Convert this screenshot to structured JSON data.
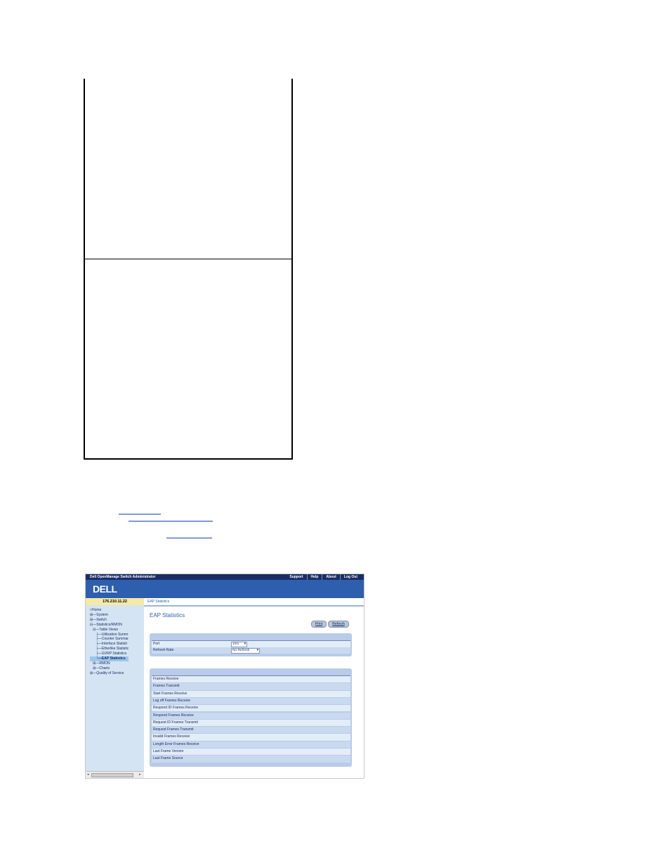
{
  "screenshot": {
    "title": "Dell OpenManage Switch Administrator",
    "nav": [
      "Support",
      "Help",
      "About",
      "Log Out"
    ],
    "logo": "DELL",
    "ip": "176.210.11.22",
    "breadcrumb": "EAP Statistics",
    "tree": [
      {
        "prefix": "□",
        "label": "Home"
      },
      {
        "prefix": "⊞—",
        "label": "System"
      },
      {
        "prefix": "⊞—",
        "label": "Switch"
      },
      {
        "prefix": "⊟—",
        "label": "Statistics/RMON"
      },
      {
        "prefix": "   ⊟—",
        "label": "Table Views"
      },
      {
        "prefix": "      ├—",
        "label": "Utilization Summ"
      },
      {
        "prefix": "      ├—",
        "label": "Counter Summar"
      },
      {
        "prefix": "      ├—",
        "label": "Interface Statisti"
      },
      {
        "prefix": "      ├—",
        "label": "Etherlike Statistic"
      },
      {
        "prefix": "      ├—",
        "label": "GVRP Statistics"
      },
      {
        "prefix": "      └—",
        "label": "EAP Statistics"
      },
      {
        "prefix": "   ⊞—",
        "label": "RMON"
      },
      {
        "prefix": "   ⊞—",
        "label": "Charts"
      },
      {
        "prefix": "⊞—",
        "label": "Quality of Service"
      }
    ],
    "page_title": "EAP Statistics",
    "print_label": "Print",
    "refresh_label": "Refresh",
    "port_label": "Port",
    "port_value": "1/e1",
    "refresh_rate_label": "Refresh Rate",
    "refresh_rate_value": "No Refresh",
    "stats": [
      "Frames Receive",
      "Frames Transmit",
      "Start Frames Receive",
      "Log off Frames Receive",
      "Respond ID Frames Receive",
      "Respond Frames Receive",
      "Request ID Frames Transmit",
      "Request Frames Transmit",
      "Invalid Frames Receive",
      "Length Error Frames Receive",
      "Last Frame Version",
      "Last Frame Source"
    ]
  }
}
